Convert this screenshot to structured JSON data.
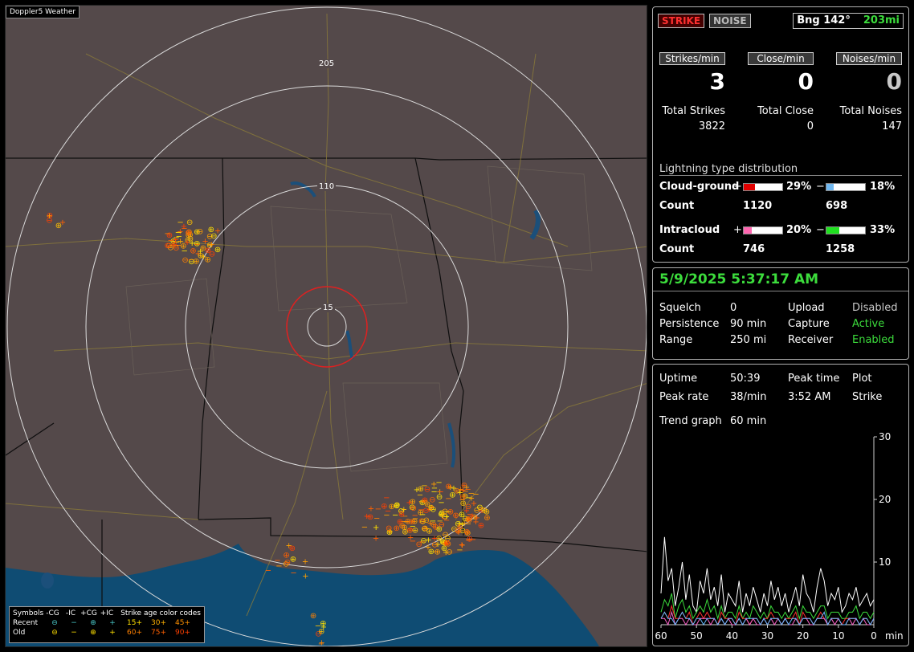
{
  "app": {
    "title": "Doppler5 Weather"
  },
  "map": {
    "range_labels": [
      "205",
      "110",
      "15"
    ],
    "legend": {
      "symbols_label": "Symbols",
      "headers": [
        "-CG",
        "-IC",
        "+CG",
        "+IC"
      ],
      "rows": [
        {
          "label": "Recent",
          "symbols": [
            "⊖",
            "−",
            "⊕",
            "+"
          ],
          "ages": [
            "15+",
            "30+",
            "45+"
          ]
        },
        {
          "label": "Old",
          "symbols": [
            "⊖",
            "−",
            "⊕",
            "+"
          ],
          "ages": [
            "60+",
            "75+",
            "90+"
          ]
        }
      ],
      "age_title": "Strike age color codes"
    }
  },
  "status": {
    "strike_btn": "STRIKE",
    "noise_btn": "NOISE",
    "bearing": "Bng 142°",
    "distance": "203mi",
    "rate_headers": [
      "Strikes/min",
      "Close/min",
      "Noises/min"
    ],
    "rates": [
      "3",
      "0",
      "0"
    ],
    "totals_labels": [
      "Total Strikes",
      "Total Close",
      "Total Noises"
    ],
    "totals": [
      "3822",
      "0",
      "147"
    ],
    "distribution_title": "Lightning type distribution",
    "cg_label": "Cloud-ground",
    "ic_label": "Intracloud",
    "count_label": "Count",
    "plus": "+",
    "minus": "−",
    "cg_pos_pct": "29%",
    "cg_neg_pct": "18%",
    "cg_pos_count": "1120",
    "cg_neg_count": "698",
    "ic_pos_pct": "20%",
    "ic_neg_pct": "33%",
    "ic_pos_count": "746",
    "ic_neg_count": "1258",
    "cg_pos_frac": 0.29,
    "cg_neg_frac": 0.18,
    "ic_pos_frac": 0.2,
    "ic_neg_frac": 0.33
  },
  "settings": {
    "datetime": "5/9/2025 5:37:17 AM",
    "squelch_label": "Squelch",
    "squelch": "0",
    "persistence_label": "Persistence",
    "persistence": "90 min",
    "range_label": "Range",
    "range": "250 mi",
    "upload_label": "Upload",
    "upload": "Disabled",
    "capture_label": "Capture",
    "capture": "Active",
    "receiver_label": "Receiver",
    "receiver": "Enabled"
  },
  "stats": {
    "uptime_label": "Uptime",
    "uptime": "50:39",
    "peak_time_label": "Peak time",
    "peak_time": "3:52 AM",
    "plot_label": "Plot",
    "plot": "Strike",
    "peak_rate_label": "Peak rate",
    "peak_rate": "38/min",
    "trend_label": "Trend graph",
    "trend": "60 min"
  },
  "chart_data": {
    "type": "line",
    "x_tick_labels": [
      "60",
      "50",
      "40",
      "30",
      "20",
      "10",
      "0"
    ],
    "x_unit": "min",
    "y_tick_labels": [
      "30",
      "20",
      "10"
    ],
    "ylim": [
      0,
      30
    ],
    "xlim": [
      60,
      0
    ],
    "colors": {
      "total": "#ffffff",
      "cg_neg": "#3cdc3c",
      "cg_pos": "#ff3030",
      "ic_pos": "#ff66cc",
      "ic_neg": "#66bbff"
    },
    "series": [
      {
        "key": "total",
        "values": [
          5,
          14,
          7,
          9,
          3,
          6,
          10,
          4,
          8,
          3,
          2,
          7,
          5,
          9,
          4,
          6,
          3,
          8,
          2,
          5,
          4,
          3,
          7,
          2,
          5,
          3,
          6,
          4,
          2,
          5,
          3,
          7,
          4,
          6,
          3,
          5,
          2,
          4,
          6,
          3,
          8,
          5,
          4,
          2,
          6,
          9,
          7,
          3,
          5,
          4,
          6,
          2,
          3,
          5,
          4,
          6,
          3,
          4,
          5,
          3,
          4
        ]
      },
      {
        "key": "cg_neg",
        "values": [
          2,
          4,
          3,
          5,
          1,
          3,
          4,
          2,
          3,
          1,
          2,
          3,
          2,
          4,
          2,
          3,
          1,
          3,
          1,
          2,
          2,
          1,
          3,
          1,
          2,
          1,
          3,
          2,
          1,
          2,
          1,
          3,
          2,
          2,
          1,
          2,
          1,
          2,
          3,
          1,
          3,
          2,
          2,
          1,
          2,
          3,
          3,
          1,
          2,
          2,
          2,
          1,
          1,
          2,
          2,
          3,
          1,
          2,
          2,
          1,
          2
        ]
      },
      {
        "key": "cg_pos",
        "values": [
          1,
          2,
          1,
          3,
          1,
          1,
          2,
          1,
          2,
          0,
          1,
          2,
          1,
          2,
          1,
          1,
          0,
          2,
          1,
          1,
          1,
          0,
          2,
          1,
          1,
          0,
          1,
          1,
          0,
          1,
          1,
          2,
          1,
          1,
          0,
          1,
          1,
          1,
          2,
          0,
          2,
          1,
          1,
          0,
          1,
          2,
          1,
          0,
          1,
          1,
          1,
          0,
          1,
          1,
          1,
          1,
          0,
          1,
          1,
          0,
          1
        ]
      },
      {
        "key": "ic_pos",
        "values": [
          1,
          1,
          0,
          2,
          0,
          1,
          1,
          0,
          1,
          0,
          0,
          1,
          1,
          1,
          0,
          1,
          0,
          1,
          0,
          1,
          0,
          0,
          1,
          0,
          1,
          0,
          1,
          0,
          0,
          1,
          0,
          1,
          0,
          1,
          0,
          1,
          0,
          0,
          1,
          0,
          1,
          1,
          0,
          0,
          1,
          1,
          1,
          0,
          1,
          0,
          1,
          0,
          0,
          1,
          0,
          1,
          0,
          1,
          0,
          0,
          1
        ]
      },
      {
        "key": "ic_neg",
        "values": [
          1,
          2,
          1,
          1,
          0,
          1,
          2,
          1,
          1,
          0,
          1,
          1,
          0,
          1,
          1,
          1,
          0,
          1,
          0,
          1,
          1,
          0,
          1,
          0,
          1,
          1,
          1,
          1,
          0,
          1,
          0,
          1,
          1,
          1,
          0,
          1,
          0,
          1,
          1,
          0,
          1,
          1,
          1,
          0,
          1,
          1,
          2,
          0,
          1,
          1,
          1,
          0,
          0,
          1,
          1,
          1,
          0,
          1,
          1,
          0,
          1
        ]
      }
    ]
  }
}
